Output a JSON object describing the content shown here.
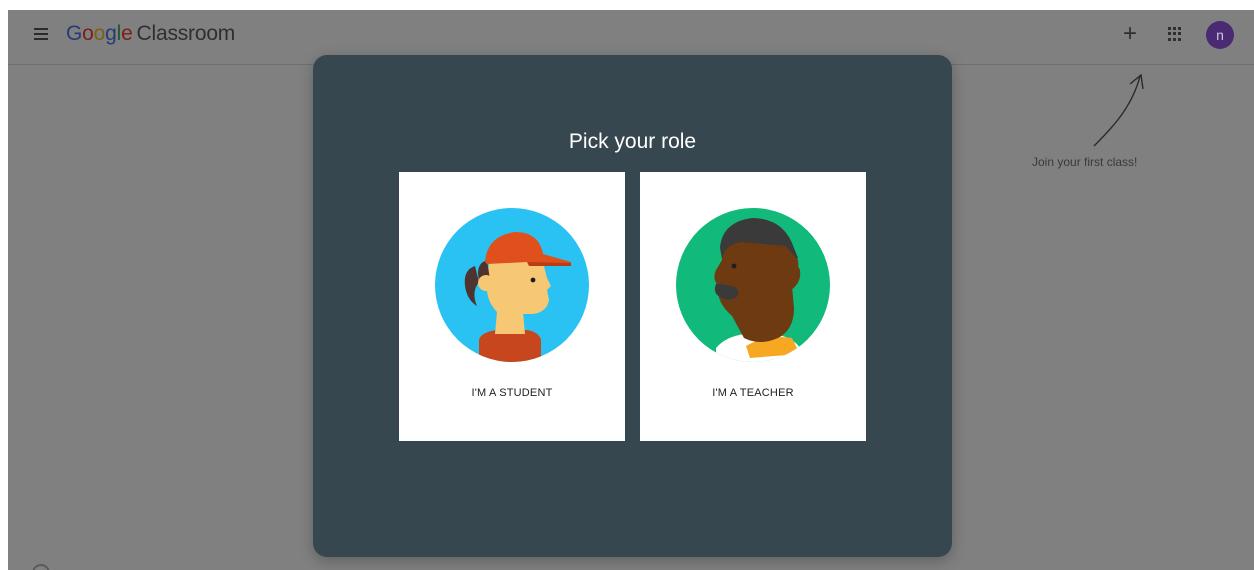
{
  "header": {
    "menu_icon": "hamburger-menu-icon",
    "logo": {
      "letters": [
        "G",
        "o",
        "o",
        "g",
        "l",
        "e"
      ],
      "product": "Classroom"
    },
    "actions": {
      "plus_label": "+",
      "plus_icon": "plus-icon",
      "apps_icon": "apps-grid-icon",
      "avatar_initial": "n"
    }
  },
  "hint": {
    "text": "Join your first class!"
  },
  "dialog": {
    "title": "Pick your role",
    "roles": [
      {
        "label": "I'M A STUDENT",
        "icon": "student-illustration-icon"
      },
      {
        "label": "I'M A TEACHER",
        "icon": "teacher-illustration-icon"
      }
    ]
  },
  "colors": {
    "overlay": "#808080",
    "dialog_bg": "#37474f",
    "card_bg": "#ffffff",
    "avatar_bg": "#4a2a73",
    "student_circle": "#29c2f2",
    "teacher_circle": "#11b97a"
  }
}
